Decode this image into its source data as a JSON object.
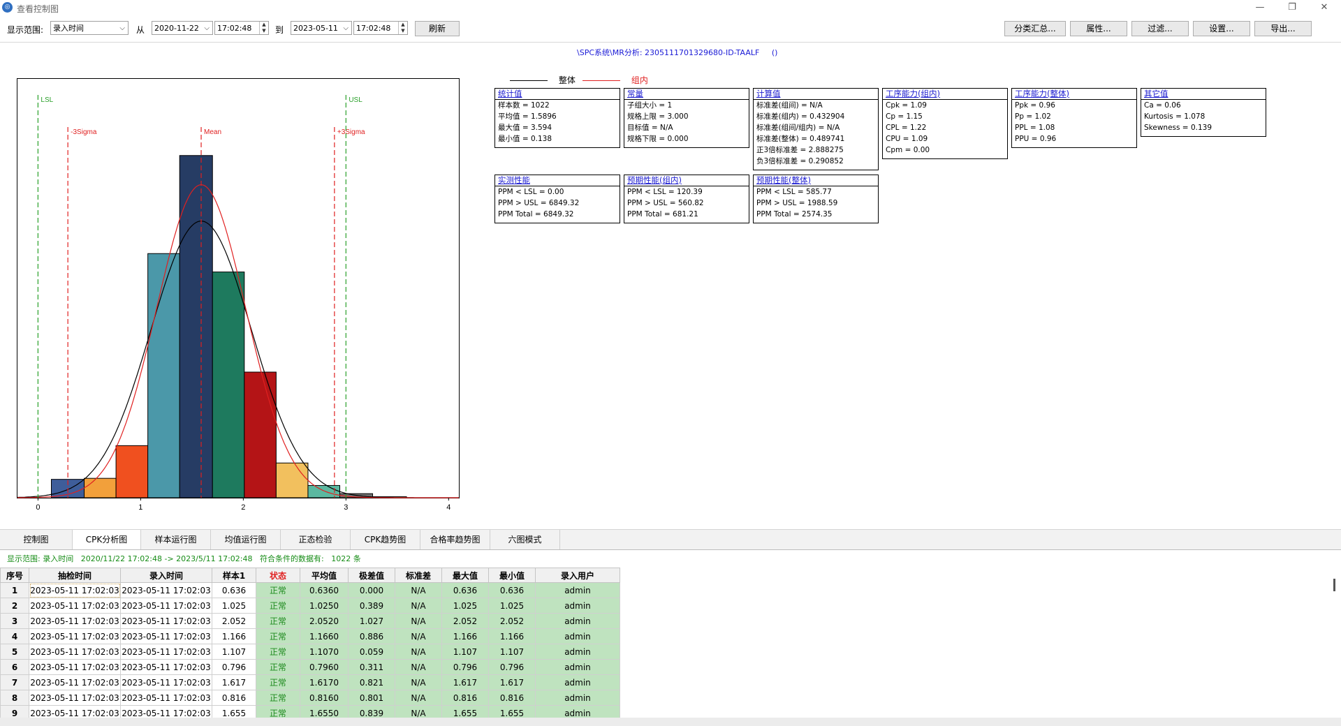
{
  "window": {
    "title": "查看控制图",
    "icon": "app-logo-icon",
    "controls": [
      "—",
      "❐",
      "✕"
    ]
  },
  "toolbar": {
    "range_label": "显示范围:",
    "range_field": "录入时间",
    "from_label": "从",
    "from_date": "2020-11-22",
    "from_time": "17:02:48",
    "to_label": "到",
    "to_date": "2023-05-11",
    "to_time": "17:02:48",
    "refresh": "刷新",
    "buttons": [
      "分类汇总...",
      "属性...",
      "过滤...",
      "设置...",
      "导出..."
    ]
  },
  "chart_title": "\\SPC系统\\MR分析: 2305111701329680-ID-TAALF",
  "chart_title_suffix": "()",
  "legend": {
    "overall": "整体",
    "within": "组内",
    "overall_color": "#000000",
    "within_color": "#e02020"
  },
  "chart_data": {
    "type": "bar",
    "x_ticks": [
      "0",
      "1",
      "2",
      "3",
      "4"
    ],
    "xlim": [
      -0.2,
      4.1
    ],
    "bins": [
      {
        "x0": 0.13,
        "x1": 0.45,
        "count": 18,
        "color": "#3e5d9a"
      },
      {
        "x0": 0.45,
        "x1": 0.76,
        "count": 19,
        "color": "#f2a03b"
      },
      {
        "x0": 0.76,
        "x1": 1.07,
        "count": 51,
        "color": "#f0501f"
      },
      {
        "x0": 1.07,
        "x1": 1.38,
        "count": 239,
        "color": "#4b98a9"
      },
      {
        "x0": 1.38,
        "x1": 1.7,
        "count": 335,
        "color": "#263c64"
      },
      {
        "x0": 1.7,
        "x1": 2.01,
        "count": 221,
        "color": "#1e7a5e"
      },
      {
        "x0": 2.01,
        "x1": 2.32,
        "count": 123,
        "color": "#b41416"
      },
      {
        "x0": 2.32,
        "x1": 2.63,
        "count": 34,
        "color": "#f2c05e"
      },
      {
        "x0": 2.63,
        "x1": 2.94,
        "count": 12,
        "color": "#5bb8a0"
      },
      {
        "x0": 2.94,
        "x1": 3.26,
        "count": 4,
        "color": "#6e6e6e"
      },
      {
        "x0": 3.26,
        "x1": 3.59,
        "count": 1,
        "color": "#e5d999"
      }
    ],
    "ymax": 410,
    "lines": [
      {
        "label": "LSL",
        "x": 0.0,
        "color": "#2aa02a"
      },
      {
        "label": "-3Sigma",
        "x": 0.291,
        "color": "#e02020"
      },
      {
        "label": "Mean",
        "x": 1.5896,
        "color": "#e02020"
      },
      {
        "label": "+3Sigma",
        "x": 2.888,
        "color": "#e02020"
      },
      {
        "label": "USL",
        "x": 3.0,
        "color": "#2aa02a"
      }
    ],
    "curves": [
      {
        "name": "整体",
        "mean": 1.5896,
        "sigma": 0.489741,
        "color": "#000000"
      },
      {
        "name": "组内",
        "mean": 1.5896,
        "sigma": 0.432904,
        "color": "#e02020"
      }
    ]
  },
  "stat_boxes": [
    {
      "title": "统计值",
      "lines": [
        "样本数 = 1022",
        "平均值 = 1.5896",
        "最大值 = 3.594",
        "最小值 = 0.138"
      ]
    },
    {
      "title": "常量",
      "lines": [
        "子组大小 = 1",
        "规格上限 = 3.000",
        "目标值 = N/A",
        "规格下限 = 0.000"
      ]
    },
    {
      "title": "计算值",
      "lines": [
        "标准差(组间) = N/A",
        "标准差(组内) = 0.432904",
        "标准差(组间/组内) = N/A",
        "标准差(整体) = 0.489741",
        "正3倍标准差 = 2.888275",
        "负3倍标准差 = 0.290852"
      ]
    },
    {
      "title": "工序能力(组内)",
      "lines": [
        "Cpk = 1.09",
        "Cp = 1.15",
        "CPL = 1.22",
        "CPU = 1.09",
        "Cpm = 0.00"
      ]
    },
    {
      "title": "工序能力(整体)",
      "lines": [
        "Ppk = 0.96",
        "Pp = 1.02",
        "PPL = 1.08",
        "PPU = 0.96"
      ]
    },
    {
      "title": "其它值",
      "lines": [
        "Ca = 0.06",
        "Kurtosis = 1.078",
        "Skewness = 0.139"
      ]
    },
    {
      "title": "实测性能",
      "lines": [
        "PPM < LSL = 0.00",
        "PPM > USL = 6849.32",
        "PPM Total = 6849.32"
      ]
    },
    {
      "title": "预期性能(组内)",
      "lines": [
        "PPM < LSL = 120.39",
        "PPM > USL = 560.82",
        "PPM Total = 681.21"
      ]
    },
    {
      "title": "预期性能(整体)",
      "lines": [
        "PPM < LSL = 585.77",
        "PPM > USL = 1988.59",
        "PPM Total = 2574.35"
      ]
    }
  ],
  "tabs": [
    "控制图",
    "CPK分析图",
    "样本运行图",
    "均值运行图",
    "正态检验",
    "CPK趋势图",
    "合格率趋势图",
    "六图模式"
  ],
  "active_tab": "CPK分析图",
  "status": {
    "label": "显示范围: 录入时间",
    "range": "2020/11/22 17:02:48 -> 2023/5/11 17:02:48",
    "count_label": "符合条件的数据有:",
    "count": "1022 条"
  },
  "table": {
    "headers": [
      "序号",
      "抽检时间",
      "录入时间",
      "样本1",
      "状态",
      "平均值",
      "极差值",
      "标准差",
      "最大值",
      "最小值",
      "录入用户"
    ],
    "rows": [
      [
        "1",
        "2023-05-11 17:02:03",
        "2023-05-11 17:02:03",
        "0.636",
        "正常",
        "0.6360",
        "0.000",
        "N/A",
        "0.636",
        "0.636",
        "admin"
      ],
      [
        "2",
        "2023-05-11 17:02:03",
        "2023-05-11 17:02:03",
        "1.025",
        "正常",
        "1.0250",
        "0.389",
        "N/A",
        "1.025",
        "1.025",
        "admin"
      ],
      [
        "3",
        "2023-05-11 17:02:03",
        "2023-05-11 17:02:03",
        "2.052",
        "正常",
        "2.0520",
        "1.027",
        "N/A",
        "2.052",
        "2.052",
        "admin"
      ],
      [
        "4",
        "2023-05-11 17:02:03",
        "2023-05-11 17:02:03",
        "1.166",
        "正常",
        "1.1660",
        "0.886",
        "N/A",
        "1.166",
        "1.166",
        "admin"
      ],
      [
        "5",
        "2023-05-11 17:02:03",
        "2023-05-11 17:02:03",
        "1.107",
        "正常",
        "1.1070",
        "0.059",
        "N/A",
        "1.107",
        "1.107",
        "admin"
      ],
      [
        "6",
        "2023-05-11 17:02:03",
        "2023-05-11 17:02:03",
        "0.796",
        "正常",
        "0.7960",
        "0.311",
        "N/A",
        "0.796",
        "0.796",
        "admin"
      ],
      [
        "7",
        "2023-05-11 17:02:03",
        "2023-05-11 17:02:03",
        "1.617",
        "正常",
        "1.6170",
        "0.821",
        "N/A",
        "1.617",
        "1.617",
        "admin"
      ],
      [
        "8",
        "2023-05-11 17:02:03",
        "2023-05-11 17:02:03",
        "0.816",
        "正常",
        "0.8160",
        "0.801",
        "N/A",
        "0.816",
        "0.816",
        "admin"
      ],
      [
        "9",
        "2023-05-11 17:02:03",
        "2023-05-11 17:02:03",
        "1.655",
        "正常",
        "1.6550",
        "0.839",
        "N/A",
        "1.655",
        "1.655",
        "admin"
      ]
    ]
  }
}
